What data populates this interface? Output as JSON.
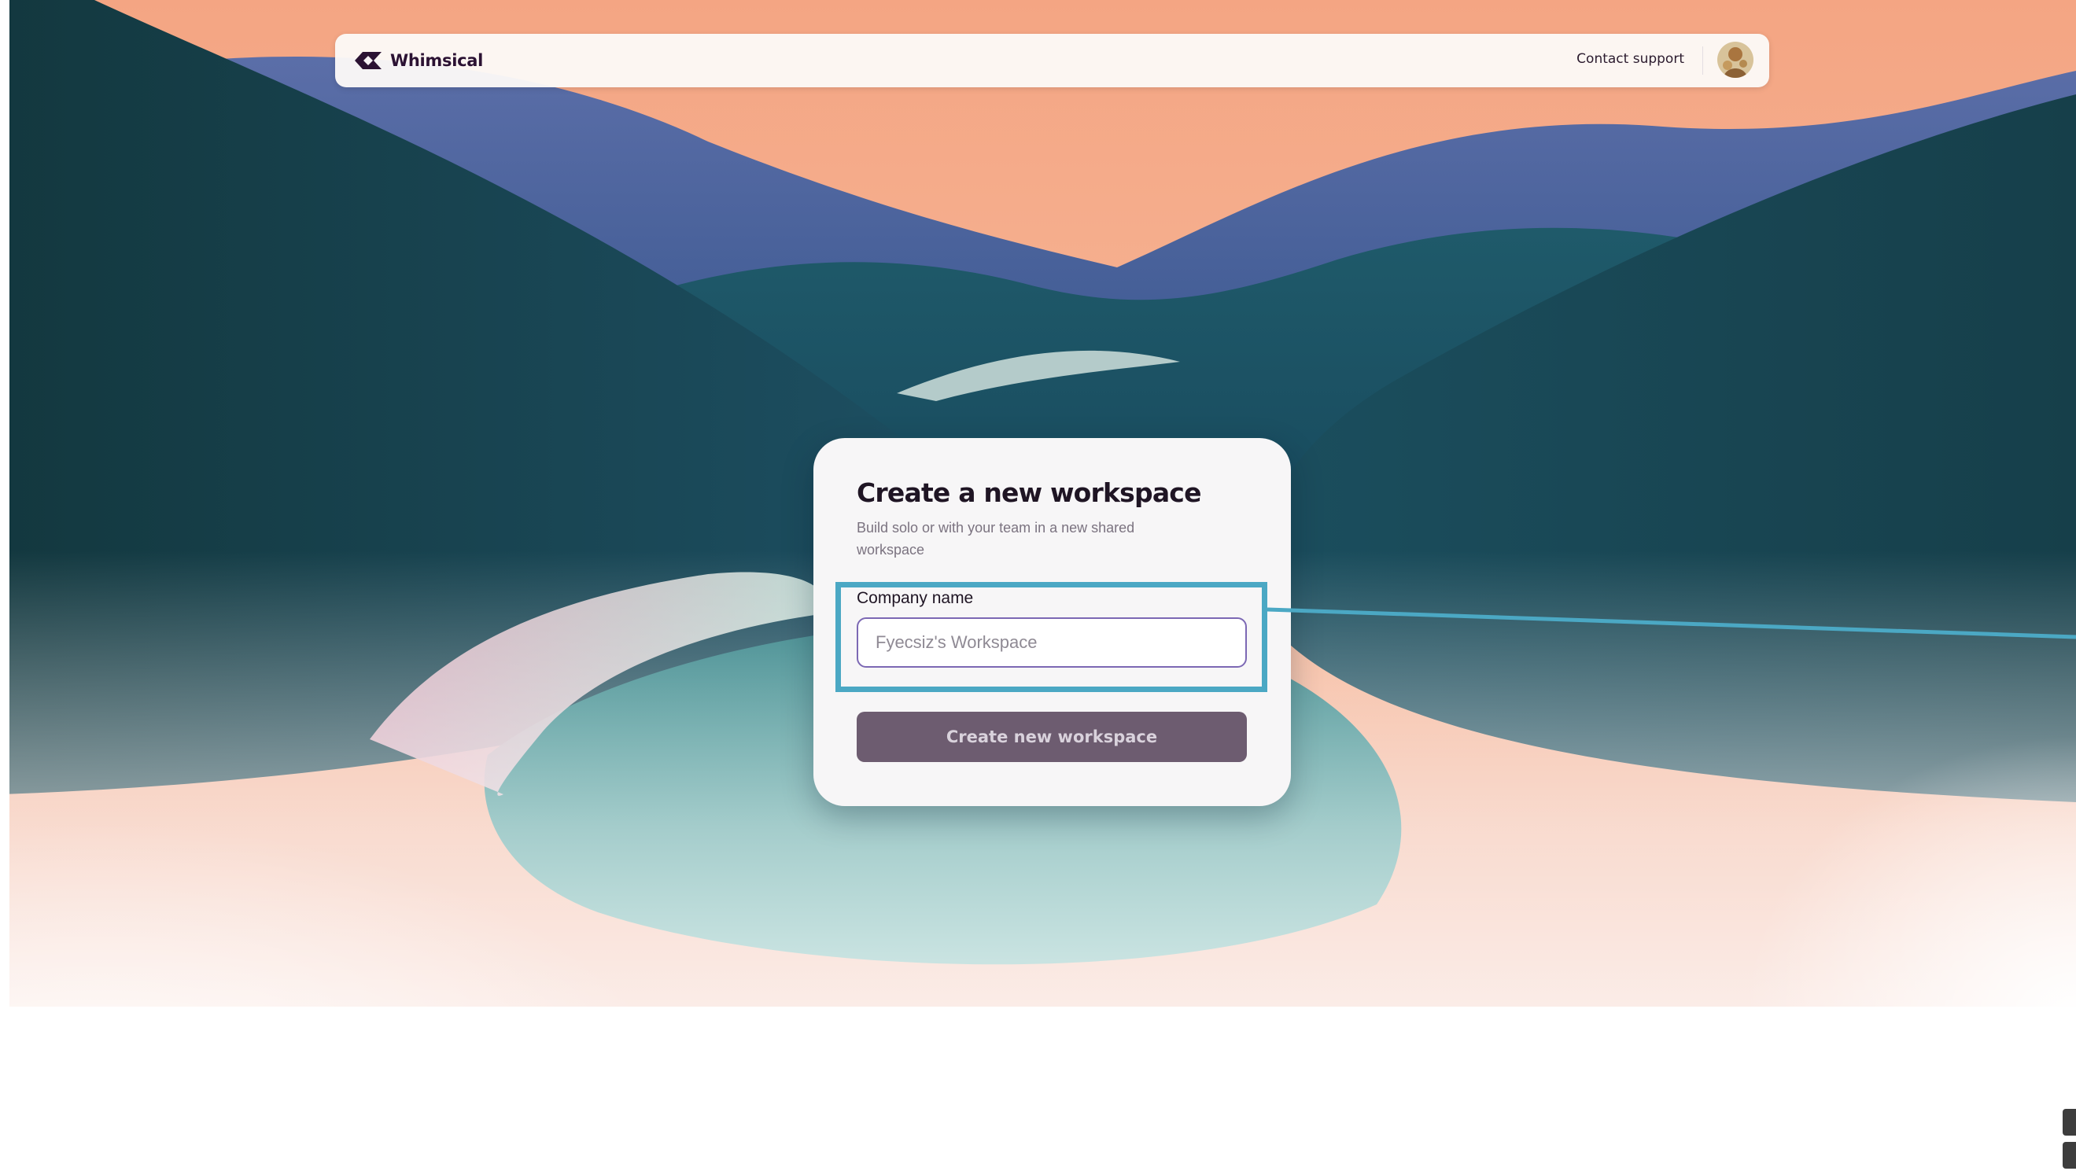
{
  "header": {
    "brand_name": "Whimsical",
    "contact_support": "Contact support"
  },
  "dialog": {
    "title": "Create a new workspace",
    "subtitle": "Build solo or with your team in a new shared workspace",
    "field_label": "Company name",
    "input_placeholder": "Fyecsiz's Workspace",
    "input_value": "",
    "submit_label": "Create new workspace"
  },
  "colors": {
    "annotation_highlight": "#4ba8c4",
    "input_focus_border": "#7c68b4",
    "submit_button_bg": "#6d5c70",
    "brand_text": "#2b1233"
  },
  "icons": {
    "brand_logo": "whimsical-logo",
    "user_avatar": "user-avatar"
  }
}
